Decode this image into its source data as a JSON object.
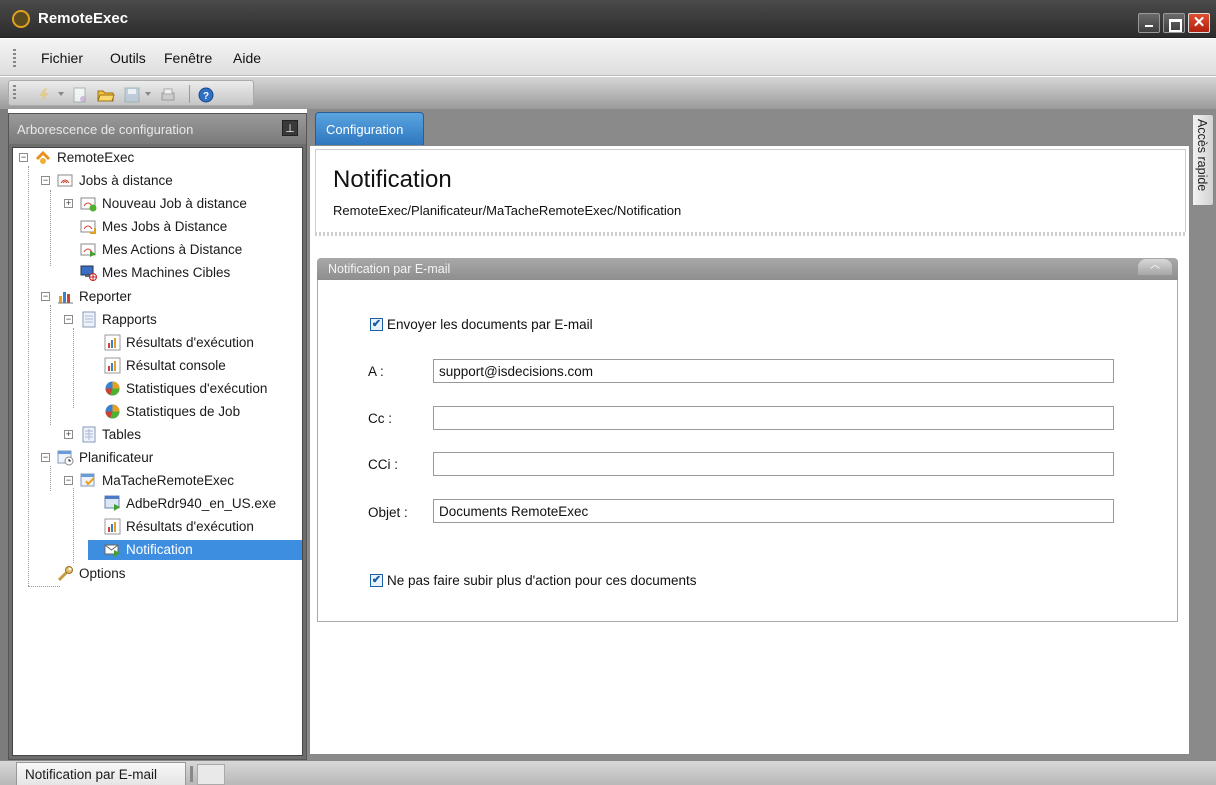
{
  "window": {
    "title": "RemoteExec"
  },
  "menu": {
    "items": [
      "Fichier",
      "Outils",
      "Fenêtre",
      "Aide"
    ]
  },
  "toolbar": {
    "icons": [
      "run-icon",
      "new-icon",
      "open-folder-icon",
      "save-icon",
      "print-icon",
      "help-icon"
    ]
  },
  "left_panel": {
    "title": "Arborescence de configuration",
    "tree": [
      {
        "label": "RemoteExec"
      },
      {
        "label": "Jobs à distance"
      },
      {
        "label": "Nouveau Job à distance"
      },
      {
        "label": "Mes Jobs à Distance"
      },
      {
        "label": "Mes Actions à Distance"
      },
      {
        "label": "Mes Machines Cibles"
      },
      {
        "label": "Reporter"
      },
      {
        "label": "Rapports"
      },
      {
        "label": "Résultats d'exécution"
      },
      {
        "label": "Résultat console"
      },
      {
        "label": "Statistiques d'exécution"
      },
      {
        "label": "Statistiques de Job"
      },
      {
        "label": "Tables"
      },
      {
        "label": "Planificateur"
      },
      {
        "label": "MaTacheRemoteExec"
      },
      {
        "label": "AdbeRdr940_en_US.exe"
      },
      {
        "label": "Résultats d'exécution"
      },
      {
        "label": "Notification"
      },
      {
        "label": "Options"
      }
    ]
  },
  "main": {
    "tab_label": "Configuration",
    "title": "Notification",
    "path": "RemoteExec/Planificateur/MaTacheRemoteExec/Notification",
    "section": {
      "title": "Notification par E-mail",
      "send_checkbox_label": "Envoyer les documents par E-mail",
      "send_checked": true,
      "fields": {
        "to_label": "A :",
        "to_value": "support@isdecisions.com",
        "cc_label": "Cc :",
        "cc_value": "",
        "bcc_label": "CCi :",
        "bcc_value": "",
        "subject_label": "Objet :",
        "subject_value": "Documents RemoteExec"
      },
      "no_action_checkbox_label": "Ne pas faire subir plus d'action pour ces documents",
      "no_action_checked": true
    }
  },
  "side_tab": {
    "label": "Accès rapide"
  },
  "status_bar": {
    "tab_label": "Notification par E-mail"
  }
}
